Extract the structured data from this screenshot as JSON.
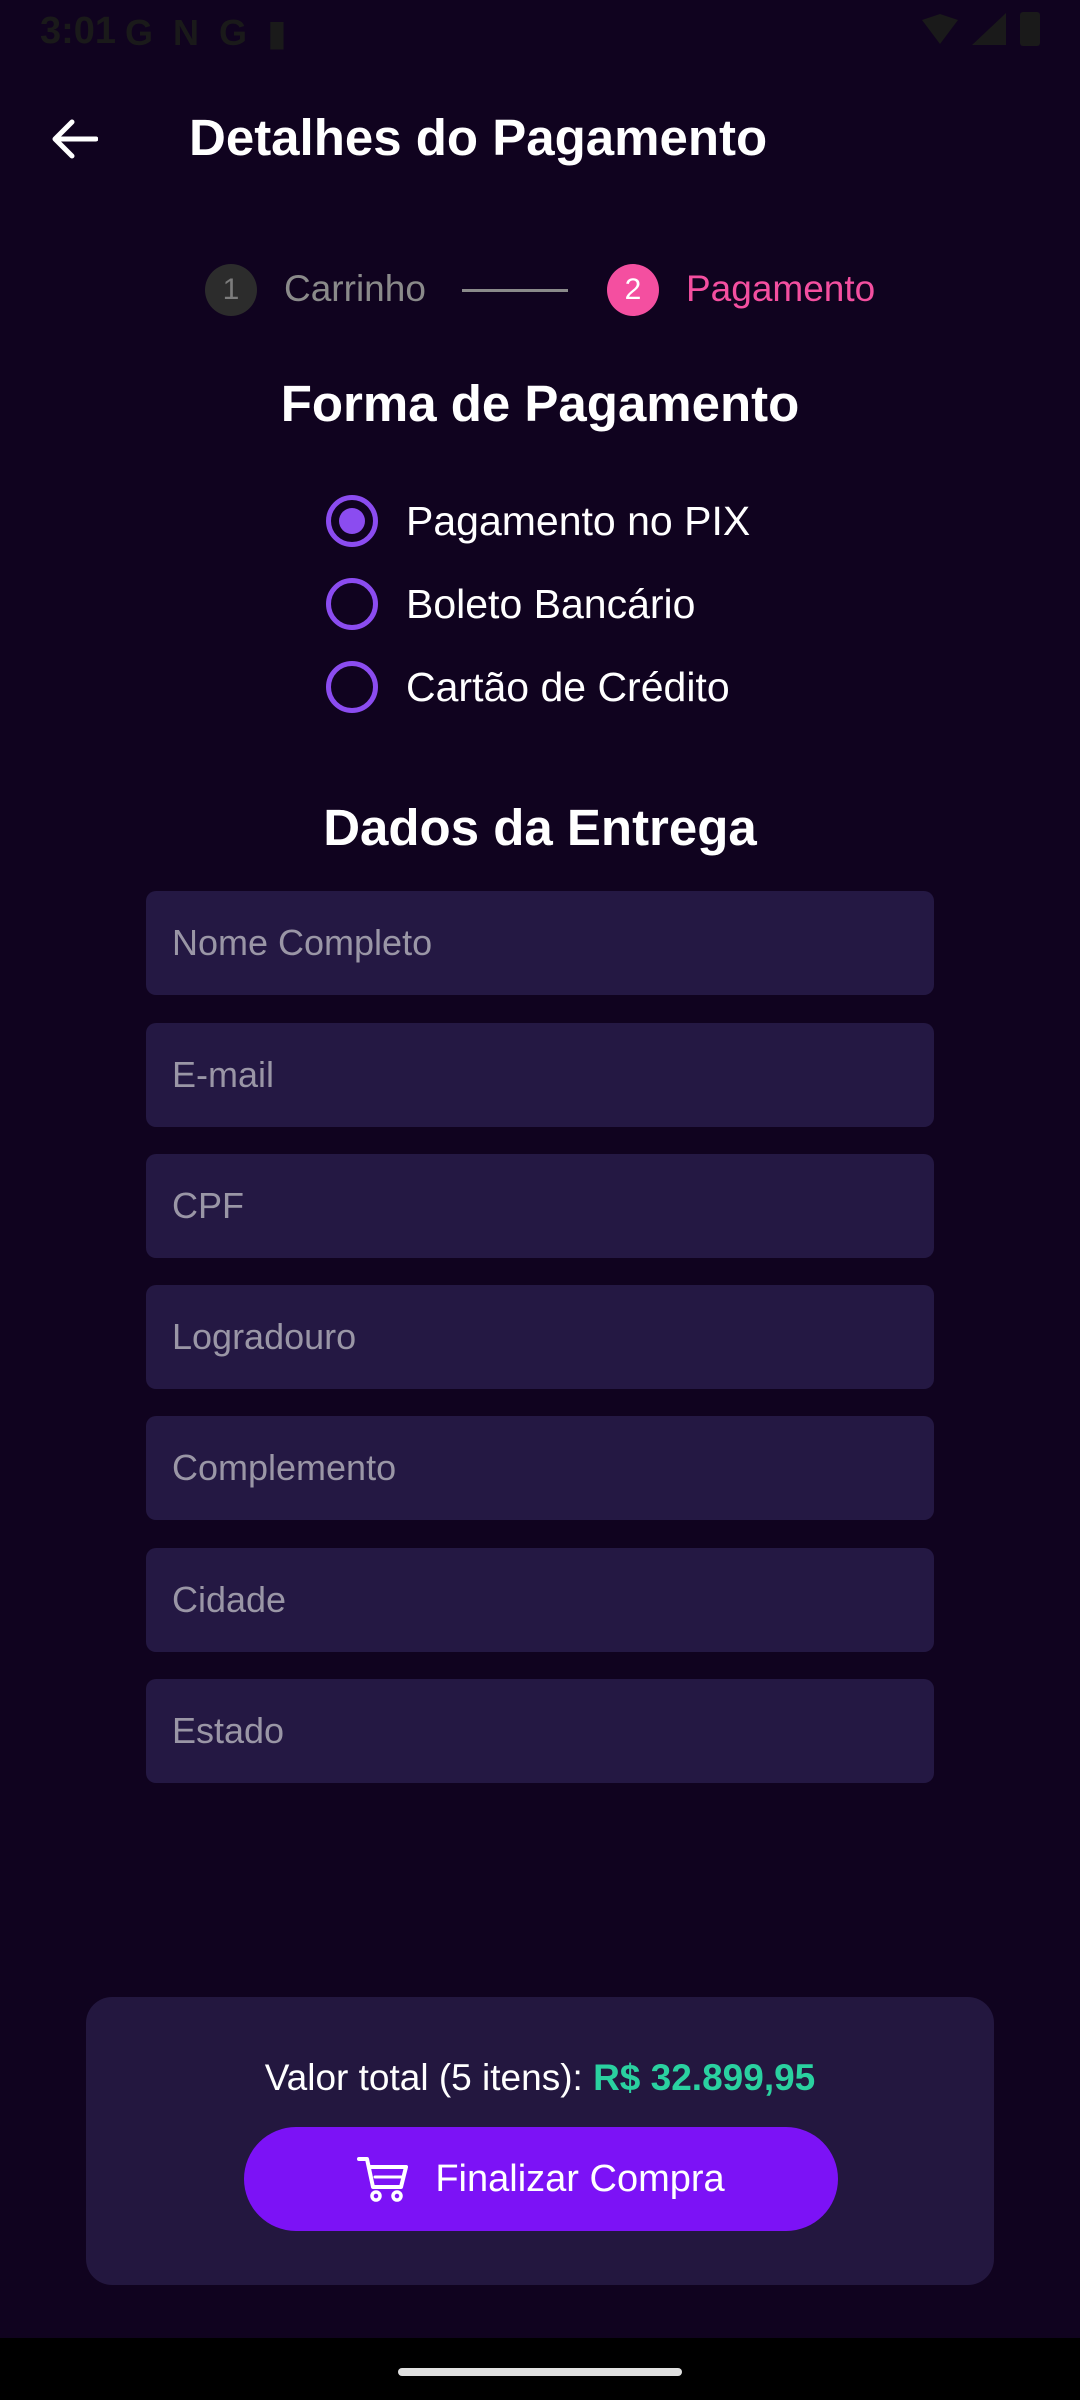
{
  "status_bar": {
    "time": "3:01",
    "left_icons": [
      "G",
      "N",
      "G",
      "▮"
    ]
  },
  "header": {
    "back_icon": "arrow-left-icon",
    "title": "Detalhes do Pagamento"
  },
  "stepper": {
    "steps": [
      {
        "number": "1",
        "label": "Carrinho",
        "state": "inactive"
      },
      {
        "number": "2",
        "label": "Pagamento",
        "state": "active"
      }
    ],
    "active_color": "#f44fa0",
    "inactive_color": "#8a8a8a"
  },
  "payment": {
    "heading": "Forma de Pagamento",
    "options": [
      {
        "label": "Pagamento no PIX",
        "selected": true
      },
      {
        "label": "Boleto Bancário",
        "selected": false
      },
      {
        "label": "Cartão de Crédito",
        "selected": false
      }
    ],
    "radio_color": "#8b4cf0"
  },
  "delivery": {
    "heading": "Dados da Entrega",
    "fields": [
      {
        "placeholder": "Nome Completo",
        "value": ""
      },
      {
        "placeholder": "E-mail",
        "value": ""
      },
      {
        "placeholder": "CPF",
        "value": ""
      },
      {
        "placeholder": "Logradouro",
        "value": ""
      },
      {
        "placeholder": "Complemento",
        "value": ""
      },
      {
        "placeholder": "Cidade",
        "value": ""
      },
      {
        "placeholder": "Estado",
        "value": ""
      }
    ]
  },
  "summary": {
    "total_label": "Valor total (5 itens): ",
    "total_amount": "R$ 32.899,95",
    "amount_color": "#2ad1a0",
    "button_label": "Finalizar Compra",
    "button_icon": "cart-icon",
    "button_color": "#7c12f6"
  },
  "colors": {
    "background": "#10031f",
    "panel": "#23173f",
    "field": "#241843"
  }
}
